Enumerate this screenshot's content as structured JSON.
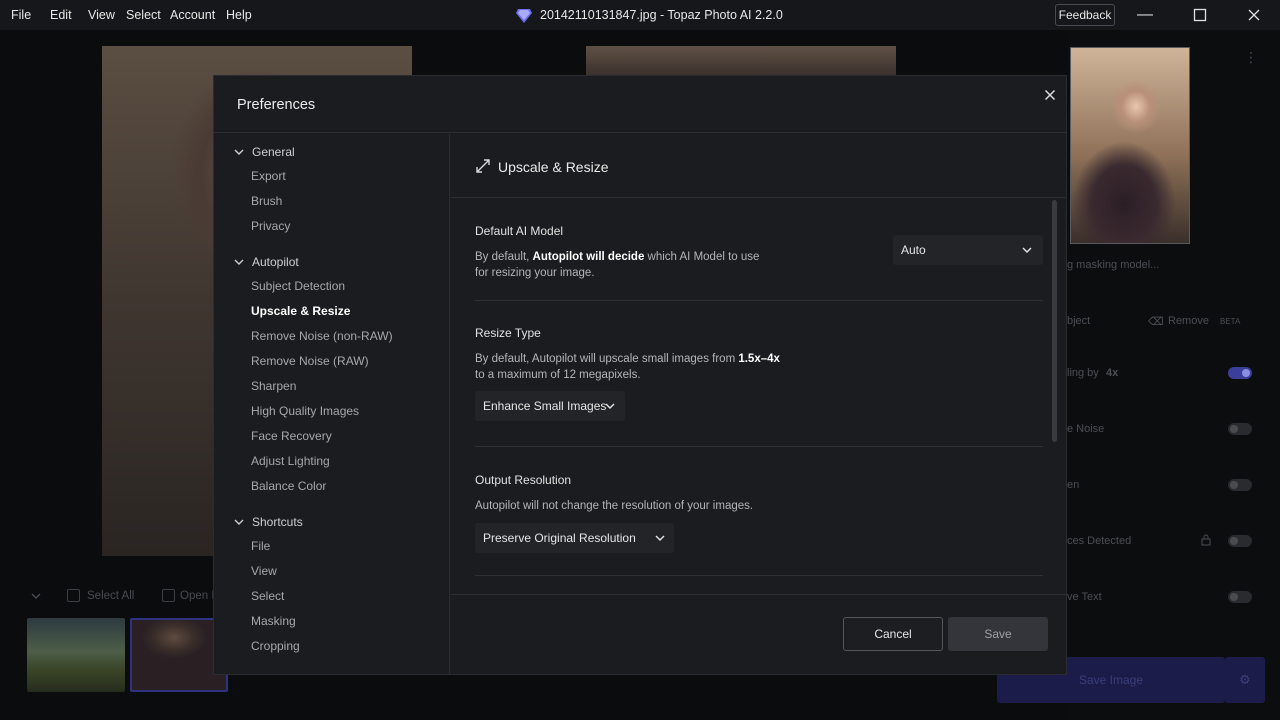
{
  "menu": {
    "items": [
      "File",
      "Edit",
      "View",
      "Select",
      "Account",
      "Help"
    ]
  },
  "window": {
    "title": "20142110131847.jpg - Topaz Photo AI 2.2.0",
    "feedback_label": "Feedback"
  },
  "background": {
    "filmstrip": {
      "select_all": "Select All",
      "open": "Open I"
    },
    "right_panel": {
      "masking_status": "g masking model...",
      "object_label": "bject",
      "remove_label": "Remove",
      "beta_badge": "BETA",
      "upscaling_label": "ling by",
      "upscaling_value": "4x",
      "noise_label": "e Noise",
      "sharpen_label": "en",
      "faces_label": "ces Detected",
      "text_label": "ve Text",
      "save_image": "Save Image"
    }
  },
  "preferences": {
    "title": "Preferences",
    "nav": [
      {
        "group": "General",
        "items": [
          "Export",
          "Brush",
          "Privacy"
        ]
      },
      {
        "group": "Autopilot",
        "items": [
          "Subject Detection",
          "Upscale & Resize",
          "Remove Noise (non-RAW)",
          "Remove Noise (RAW)",
          "Sharpen",
          "High Quality Images",
          "Face Recovery",
          "Adjust Lighting",
          "Balance Color"
        ]
      },
      {
        "group": "Shortcuts",
        "items": [
          "File",
          "View",
          "Select",
          "Masking",
          "Cropping"
        ]
      }
    ],
    "active_item": "Upscale & Resize",
    "section_title": "Upscale & Resize",
    "default_model": {
      "title": "Default AI Model",
      "desc_pre": "By default, ",
      "desc_bold": "Autopilot will decide",
      "desc_post": " which AI Model to use for resizing your image.",
      "value": "Auto"
    },
    "resize_type": {
      "title": "Resize Type",
      "desc_pre": "By default, Autopilot will upscale small images from ",
      "desc_bold": "1.5x–4x",
      "desc_post": " to a maximum of 12 megapixels.",
      "value": "Enhance Small Images"
    },
    "output_resolution": {
      "title": "Output Resolution",
      "desc": "Autopilot will not change the resolution of your images.",
      "value": "Preserve Original Resolution"
    },
    "buttons": {
      "cancel": "Cancel",
      "save": "Save"
    }
  },
  "colors": {
    "modal_bg": "#1b1c20",
    "accent": "#3b3f9a"
  }
}
